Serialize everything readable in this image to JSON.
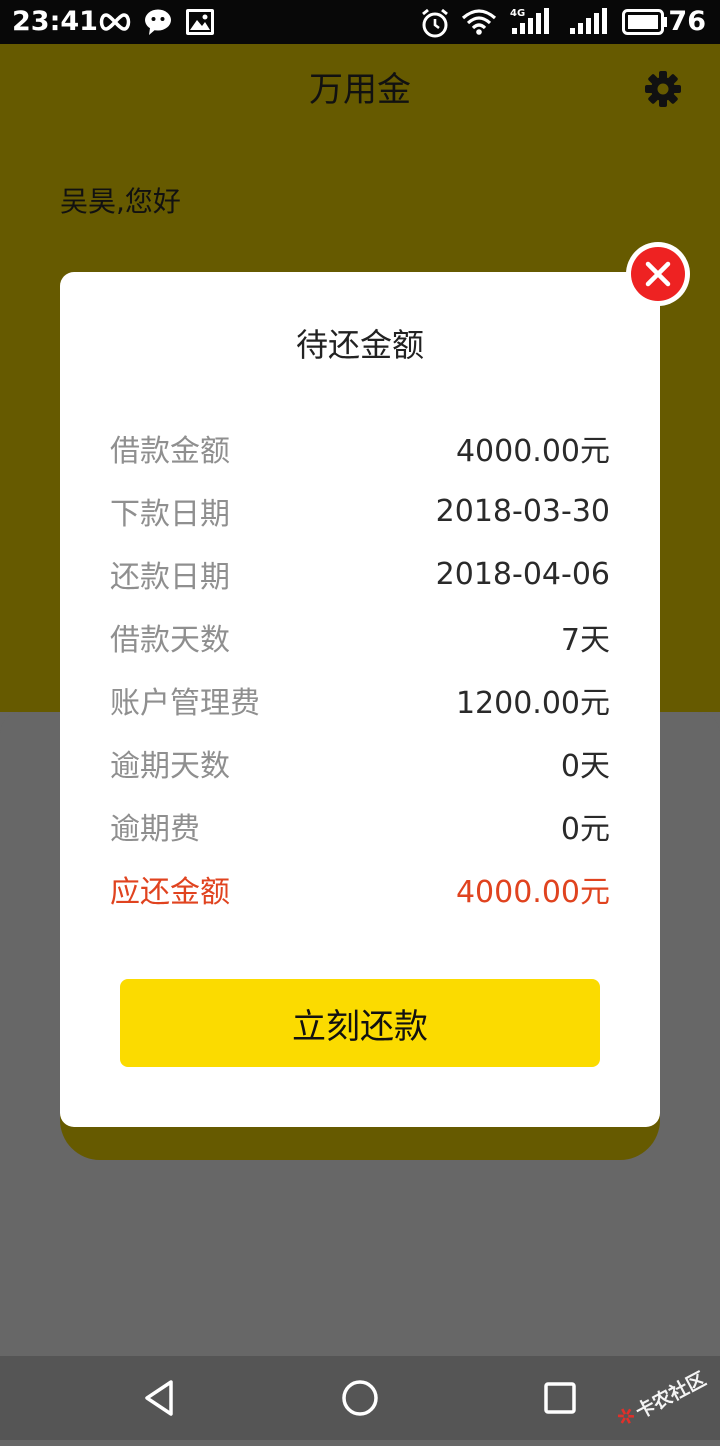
{
  "status_bar": {
    "time": "23:41",
    "battery": "76",
    "network_label": "4G"
  },
  "header": {
    "title": "万用金",
    "greeting": "吴昊,您好"
  },
  "modal": {
    "title": "待还金额",
    "rows": [
      {
        "label": "借款金额",
        "value": "4000.00元"
      },
      {
        "label": "下款日期",
        "value": "2018-03-30"
      },
      {
        "label": "还款日期",
        "value": "2018-04-06"
      },
      {
        "label": "借款天数",
        "value": "7天"
      },
      {
        "label": "账户管理费",
        "value": "1200.00元"
      },
      {
        "label": "逾期天数",
        "value": "0天"
      },
      {
        "label": "逾期费",
        "value": "0元"
      },
      {
        "label": "应还金额",
        "value": "4000.00元"
      }
    ],
    "pay_button": "立刻还款"
  },
  "watermark": {
    "text": "卡农社区"
  },
  "colors": {
    "header_bg": "#665a00",
    "accent_button": "#fbdb00",
    "highlight_red": "#e0431f",
    "close_red": "#ee2222"
  },
  "icons": {
    "status_left": [
      "infinity-icon",
      "wechat-icon",
      "image-icon"
    ],
    "status_right": [
      "alarm-icon",
      "wifi-icon",
      "signal-icon",
      "signal-icon",
      "battery-icon"
    ],
    "header": "gear-icon",
    "modal_close": "close-icon",
    "nav": [
      "back-icon",
      "home-icon",
      "recents-icon"
    ]
  }
}
